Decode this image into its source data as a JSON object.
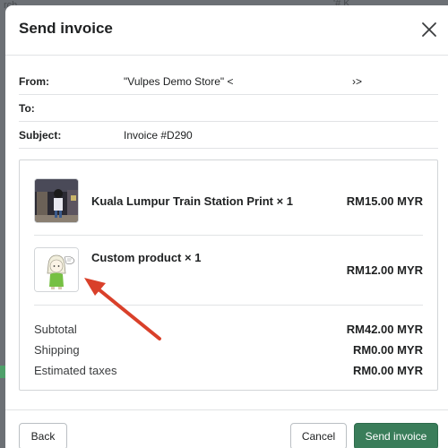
{
  "background": {
    "text_left": "rch",
    "text_right": "'# K"
  },
  "modal": {
    "title": "Send invoice",
    "close_icon": "close-icon"
  },
  "fields": {
    "from_label": "From:",
    "from_value": "\"Vulpes Demo Store\" <",
    "from_tail": "›>",
    "to_label": "To:",
    "to_value": "",
    "subject_label": "Subject:",
    "subject_value": "Invoice #D290"
  },
  "line_items": [
    {
      "title": "Kuala Lumpur Train Station Print × 1",
      "price": "RM15.00 MYR",
      "image": "train-station-photo"
    },
    {
      "title": "Custom product × 1",
      "price": "RM12.00 MYR",
      "image": "custom-character-drawing"
    }
  ],
  "totals": [
    {
      "label": "Subtotal",
      "value": "RM42.00 MYR"
    },
    {
      "label": "Shipping",
      "value": "RM0.00 MYR"
    },
    {
      "label": "Estimated taxes",
      "value": "RM0.00 MYR"
    }
  ],
  "footer": {
    "back_label": "Back",
    "cancel_label": "Cancel",
    "send_label": "Send invoice"
  },
  "colors": {
    "primary_button": "#3a7d5a",
    "annotation_arrow": "#d9402a"
  }
}
